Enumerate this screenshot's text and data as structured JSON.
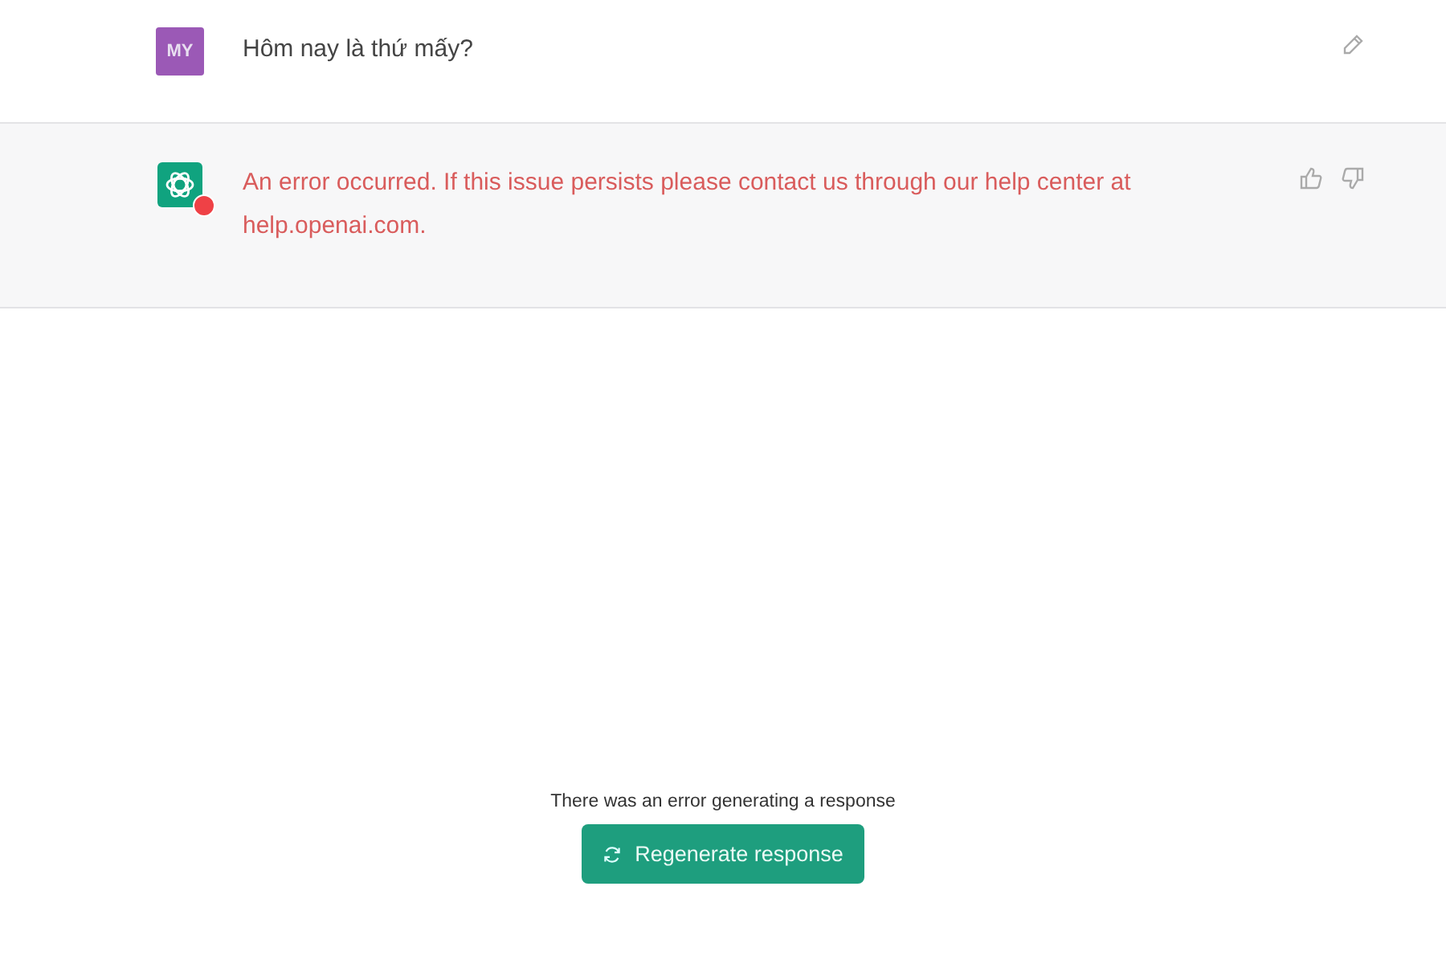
{
  "messages": [
    {
      "kind": "user",
      "avatar": "MY",
      "text": "Hôm nay là thứ mấy?",
      "error": false
    },
    {
      "kind": "assistant",
      "text": "An error occurred. If this issue persists please contact us through our help center at help.openai.com.",
      "error": true
    }
  ],
  "footer": {
    "error_text": "There was an error generating a response",
    "button": "Regenerate response"
  }
}
